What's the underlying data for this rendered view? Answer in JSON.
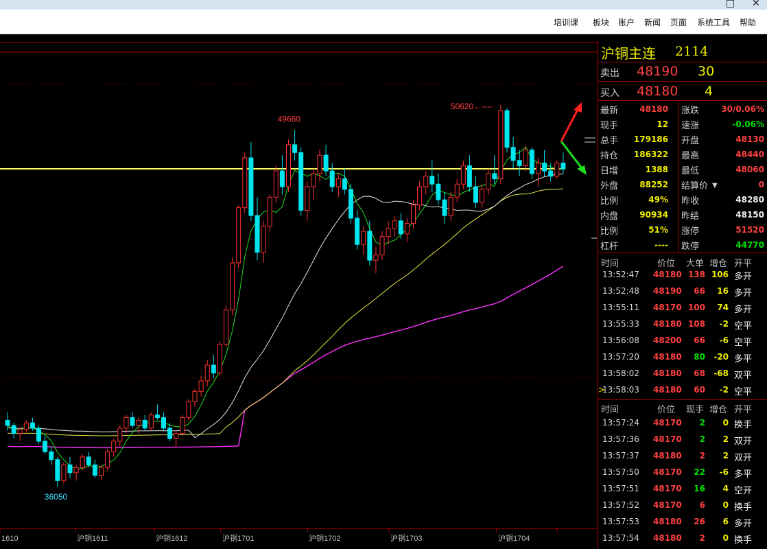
{
  "window": {
    "buttons": {
      "restore": "□",
      "close": "✕"
    }
  },
  "menu": {
    "items": [
      "培训课",
      "板块",
      "账户",
      "新闻",
      "页面",
      "系统工具",
      "帮助"
    ]
  },
  "colors": {
    "up": "#ff3030",
    "down": "#00e5ee",
    "ma_white": "#e8e8e8",
    "ma_yellow": "#e8e840",
    "ma_magenta": "#ff30ff",
    "ma_green": "#22dd22",
    "hline": "#ffff60"
  },
  "chart_data": {
    "type": "candlestick",
    "x_labels": [
      "1610",
      "沪铜1611",
      "沪铜1612",
      "沪铜1701",
      "沪铜1702",
      "沪铜1703",
      "沪铜1704"
    ],
    "annotations": {
      "high_1": "50620",
      "high_2": "49660",
      "low": "36050"
    },
    "ylim": [
      35000,
      52000
    ],
    "horizontal_line": 48180,
    "candles": [
      [
        38600,
        38900,
        38200,
        38400
      ],
      [
        38400,
        38500,
        37900,
        38100
      ],
      [
        38100,
        38300,
        37800,
        38250
      ],
      [
        38250,
        38600,
        38100,
        38500
      ],
      [
        38500,
        38700,
        38200,
        38300
      ],
      [
        38300,
        38400,
        37700,
        37800
      ],
      [
        37800,
        38000,
        37300,
        37400
      ],
      [
        37400,
        37600,
        36900,
        37100
      ],
      [
        37100,
        37200,
        36050,
        36300
      ],
      [
        36300,
        37000,
        36200,
        36900
      ],
      [
        36900,
        37200,
        36400,
        36600
      ],
      [
        36600,
        36900,
        36300,
        36800
      ],
      [
        36800,
        37300,
        36700,
        37200
      ],
      [
        37200,
        37400,
        36800,
        36900
      ],
      [
        36900,
        37100,
        36400,
        36500
      ],
      [
        36500,
        36900,
        36300,
        36800
      ],
      [
        36800,
        37500,
        36700,
        37400
      ],
      [
        37400,
        37900,
        37200,
        37800
      ],
      [
        37800,
        38400,
        37600,
        38300
      ],
      [
        38300,
        38800,
        38100,
        38700
      ],
      [
        38700,
        38900,
        38300,
        38400
      ],
      [
        38400,
        38700,
        38100,
        38600
      ],
      [
        38600,
        38800,
        38200,
        38300
      ],
      [
        38300,
        38900,
        38200,
        38800
      ],
      [
        38800,
        39200,
        38600,
        38700
      ],
      [
        38700,
        38900,
        38200,
        38300
      ],
      [
        38300,
        38500,
        37800,
        37900
      ],
      [
        37900,
        38200,
        37600,
        38100
      ],
      [
        38100,
        38800,
        38000,
        38700
      ],
      [
        38700,
        39400,
        38600,
        39300
      ],
      [
        39300,
        39800,
        39100,
        39700
      ],
      [
        39700,
        40300,
        39500,
        40100
      ],
      [
        40100,
        40900,
        39900,
        40700
      ],
      [
        40700,
        41100,
        40200,
        40400
      ],
      [
        40400,
        41600,
        40300,
        41500
      ],
      [
        41500,
        43000,
        41400,
        42800
      ],
      [
        42800,
        44800,
        42600,
        44600
      ],
      [
        44600,
        46800,
        44400,
        46700
      ],
      [
        46700,
        48800,
        46500,
        48600
      ],
      [
        48600,
        49200,
        46200,
        46400
      ],
      [
        46400,
        47100,
        44700,
        45000
      ],
      [
        45000,
        46200,
        44600,
        46000
      ],
      [
        46000,
        47200,
        45800,
        47100
      ],
      [
        47100,
        48300,
        46900,
        48100
      ],
      [
        48100,
        48700,
        47200,
        47500
      ],
      [
        47500,
        49300,
        47300,
        49100
      ],
      [
        49100,
        49660,
        48500,
        48800
      ],
      [
        48800,
        49000,
        46400,
        46600
      ],
      [
        46600,
        47700,
        46200,
        47500
      ],
      [
        47500,
        48200,
        47000,
        48000
      ],
      [
        48000,
        48900,
        47700,
        48700
      ],
      [
        48700,
        49100,
        47900,
        48100
      ],
      [
        48100,
        48400,
        47300,
        47500
      ],
      [
        47500,
        48000,
        47100,
        47800
      ],
      [
        47800,
        48200,
        47200,
        47400
      ],
      [
        47400,
        47600,
        46100,
        46300
      ],
      [
        46300,
        46600,
        45100,
        45300
      ],
      [
        45300,
        46000,
        44900,
        45800
      ],
      [
        45800,
        46200,
        44500,
        44700
      ],
      [
        44700,
        45200,
        44200,
        44900
      ],
      [
        44900,
        45800,
        44700,
        45600
      ],
      [
        45600,
        46200,
        45300,
        45900
      ],
      [
        45900,
        46400,
        45600,
        46200
      ],
      [
        46200,
        46500,
        45500,
        45700
      ],
      [
        45700,
        46300,
        45400,
        46100
      ],
      [
        46100,
        47000,
        45900,
        46800
      ],
      [
        46800,
        47700,
        46600,
        47500
      ],
      [
        47500,
        48100,
        47200,
        47900
      ],
      [
        47900,
        48500,
        47300,
        47600
      ],
      [
        47600,
        48000,
        46800,
        47000
      ],
      [
        47000,
        47300,
        46100,
        46400
      ],
      [
        46400,
        47300,
        46200,
        47100
      ],
      [
        47100,
        47800,
        46900,
        47600
      ],
      [
        47600,
        48500,
        47400,
        48300
      ],
      [
        48300,
        48700,
        47300,
        47500
      ],
      [
        47500,
        47900,
        46700,
        46900
      ],
      [
        46900,
        47600,
        46700,
        47400
      ],
      [
        47400,
        48200,
        47200,
        48000
      ],
      [
        48000,
        48700,
        47600,
        47800
      ],
      [
        47800,
        50620,
        47600,
        50400
      ],
      [
        50400,
        50500,
        48800,
        49000
      ],
      [
        49000,
        49400,
        48200,
        48500
      ],
      [
        48500,
        48900,
        47900,
        48300
      ],
      [
        48300,
        49100,
        48100,
        48900
      ],
      [
        48900,
        49000,
        47800,
        48000
      ],
      [
        48000,
        48600,
        47500,
        48400
      ],
      [
        48400,
        48900,
        47900,
        48100
      ],
      [
        48100,
        48400,
        47700,
        47900
      ],
      [
        47900,
        48500,
        47800,
        48400
      ],
      [
        48400,
        48800,
        48000,
        48180
      ]
    ]
  },
  "quote": {
    "name": "沪铜主连",
    "code": "2114",
    "ask_label": "卖出",
    "ask_price": "48190",
    "ask_vol": "30",
    "bid_label": "买入",
    "bid_price": "48180",
    "bid_vol": "4",
    "stats": [
      {
        "l1": "最新",
        "v1": "48180",
        "c1": "red",
        "l2": "涨跌",
        "v2": "30/0.06%",
        "c2": "red"
      },
      {
        "l1": "现手",
        "v1": "12",
        "c1": "yellow",
        "l2": "速涨",
        "v2": "-0.06%",
        "c2": "green"
      },
      {
        "l1": "总手",
        "v1": "179186",
        "c1": "yellow",
        "l2": "开盘",
        "v2": "48130",
        "c2": "red"
      },
      {
        "l1": "持仓",
        "v1": "186322",
        "c1": "yellow",
        "l2": "最高",
        "v2": "48440",
        "c2": "red"
      },
      {
        "l1": "日增",
        "v1": "1388",
        "c1": "yellow",
        "l2": "最低",
        "v2": "48060",
        "c2": "red"
      },
      {
        "l1": "外盘",
        "v1": "88252",
        "c1": "yellow",
        "l2": "结算价",
        "v2": "0",
        "c2": "red"
      },
      {
        "l1": "比例",
        "v1": "49%",
        "c1": "yellow",
        "l2": "昨收",
        "v2": "48280",
        "c2": "white"
      },
      {
        "l1": "内盘",
        "v1": "90934",
        "c1": "yellow",
        "l2": "昨结",
        "v2": "48150",
        "c2": "white"
      },
      {
        "l1": "比例",
        "v1": "51%",
        "c1": "yellow",
        "l2": "涨停",
        "v2": "51520",
        "c2": "red"
      },
      {
        "l1": "杠杆",
        "v1": "----",
        "c1": "yellow",
        "l2": "跌停",
        "v2": "44770",
        "c2": "green"
      }
    ]
  },
  "big_trades": {
    "headers": [
      "时间",
      "价位",
      "大单",
      "增仓",
      "开平"
    ],
    "rows": [
      {
        "time": "13:52:47",
        "price": "48180",
        "size": "138",
        "oi": "106",
        "type": "多开",
        "sc": "red",
        "oc": "yellow",
        "mark": ""
      },
      {
        "time": "13:52:48",
        "price": "48190",
        "size": "66",
        "oi": "16",
        "type": "多开",
        "sc": "red",
        "oc": "yellow",
        "mark": ""
      },
      {
        "time": "13:55:11",
        "price": "48170",
        "size": "100",
        "oi": "74",
        "type": "多开",
        "sc": "red",
        "oc": "yellow",
        "mark": ""
      },
      {
        "time": "13:55:33",
        "price": "48180",
        "size": "108",
        "oi": "-2",
        "type": "空平",
        "sc": "red",
        "oc": "yellow",
        "mark": ""
      },
      {
        "time": "13:56:08",
        "price": "48200",
        "size": "66",
        "oi": "-6",
        "type": "空平",
        "sc": "red",
        "oc": "yellow",
        "mark": ""
      },
      {
        "time": "13:57:20",
        "price": "48180",
        "size": "80",
        "oi": "-20",
        "type": "多平",
        "sc": "green",
        "oc": "yellow",
        "mark": ""
      },
      {
        "time": "13:58:02",
        "price": "48180",
        "size": "68",
        "oi": "-68",
        "type": "双平",
        "sc": "red",
        "oc": "yellow",
        "mark": ""
      },
      {
        "time": "13:58:03",
        "price": "48180",
        "size": "60",
        "oi": "-2",
        "type": "空平",
        "sc": "red",
        "oc": "yellow",
        "mark": ">"
      }
    ]
  },
  "ticks": {
    "headers": [
      "时间",
      "价位",
      "现手",
      "增仓",
      "开平"
    ],
    "rows": [
      {
        "time": "13:57:24",
        "price": "48170",
        "vol": "2",
        "oi": "0",
        "type": "换手",
        "vc": "green"
      },
      {
        "time": "13:57:36",
        "price": "48170",
        "vol": "2",
        "oi": "2",
        "type": "双开",
        "vc": "green"
      },
      {
        "time": "13:57:37",
        "price": "48180",
        "vol": "2",
        "oi": "2",
        "type": "双开",
        "vc": "red"
      },
      {
        "time": "13:57:50",
        "price": "48170",
        "vol": "22",
        "oi": "-6",
        "type": "多平",
        "vc": "green"
      },
      {
        "time": "13:57:51",
        "price": "48170",
        "vol": "16",
        "oi": "4",
        "type": "空开",
        "vc": "green"
      },
      {
        "time": "13:57:52",
        "price": "48170",
        "vol": "6",
        "oi": "0",
        "type": "换手",
        "vc": "red"
      },
      {
        "time": "13:57:53",
        "price": "48180",
        "vol": "26",
        "oi": "6",
        "type": "多开",
        "vc": "red"
      },
      {
        "time": "13:57:54",
        "price": "48180",
        "vol": "2",
        "oi": "0",
        "type": "换手",
        "vc": "red"
      }
    ]
  }
}
